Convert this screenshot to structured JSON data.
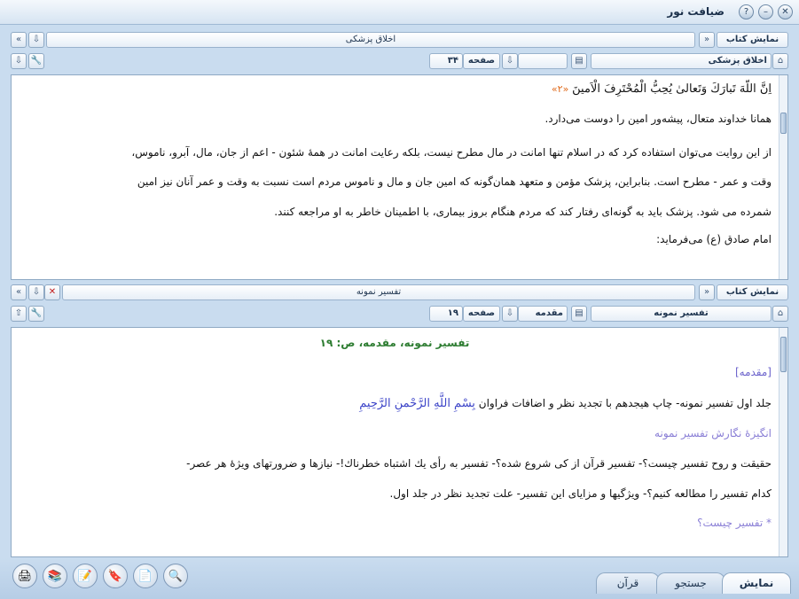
{
  "window": {
    "title": "ضیافت نور"
  },
  "top": {
    "show_book_label": "نمایش کتاب",
    "book_selector": "اخلاق پزشکی",
    "book_field": "اخلاق پزشکی",
    "page_label": "صفحه",
    "page_value": "۳۴",
    "section_value": "",
    "lines": [
      "اِنَّ اللّهَ تَبارَكَ وَتَعالىٰ يُحِبُّ الْمُحْتَرِفَ الْاَمينَ",
      "«۲»",
      "همانا خداوند متعال، پیشه‌ور امین را دوست می‌دارد.",
      "از این روایت می‌توان استفاده کرد که در اسلام تنها امانت در مال مطرح نیست، بلکه رعایت امانت در همهٔ شئون - اعم از جان، مال، آبرو، ناموس،",
      "وقت و عمر - مطرح است. بنابراین، پزشک مؤمن و متعهد همان‌گونه که امین جان و مال و ناموس مردم است نسبت به وقت و عمر آنان نیز امین",
      "شمرده می شود. پزشک باید به گونه‌ای رفتار کند که مردم هنگام بروز بیماری، با اطمینان خاطر به او مراجعه کنند.",
      "امام صادق (ع) می‌فرماید:"
    ]
  },
  "bottom": {
    "show_book_label": "نمایش کتاب",
    "book_selector": "تفسیر نمونه",
    "book_field": "تفسیر نمونه",
    "page_label": "صفحه",
    "page_value": "۱۹",
    "section_value": "مقدمه",
    "heading": "تفسیر نمونه، مقدمه، ص: ۱۹",
    "section_tag": "[مقدمه]",
    "lines": [
      "جلد اول تفسیر نمونه- چاپ هیجدهم با تجدید نظر و اضافات فراوان",
      "بِسْمِ اللَّهِ الرَّحْمنِ الرَّحِيمِ",
      "انگیزهٔ نگارش تفسیر نمونه",
      "حقیقت و روح تفسیر چیست؟- تفسیر قرآن از کی شروع شده؟- تفسیر به رأی یك اشتباه خطرناك!- نیازها و ضرورتهای ویژهٔ هر عصر-",
      "کدام تفسیر را مطالعه کنیم؟- ویژگیها و مزایای این تفسیر- علت تجدید نظر در جلد اول.",
      "* تفسیر چیست؟"
    ]
  },
  "tabs": [
    {
      "label": "نمایش"
    },
    {
      "label": "جستجو"
    },
    {
      "label": "قرآن"
    }
  ],
  "colors": {
    "accent": "#2e7d32",
    "link": "#3c44c8",
    "lavender": "#8a7fd6"
  }
}
